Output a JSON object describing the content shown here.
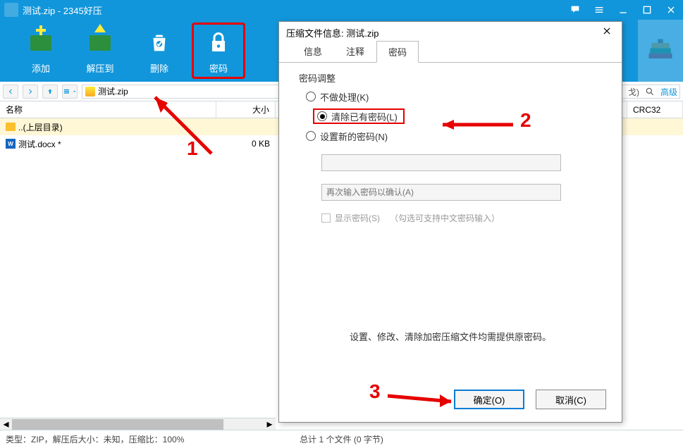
{
  "titlebar": {
    "title": "测试.zip - 2345好压"
  },
  "ribbon": {
    "add": "添加",
    "extract": "解压到",
    "delete": "删除",
    "password": "密码"
  },
  "path": "测试.zip",
  "right_fade": {
    "suffix": "戈)",
    "detail": "高级"
  },
  "columns": {
    "name": "名称",
    "size": "大小",
    "crc": "CRC32"
  },
  "rows": {
    "up": "..(上层目录)",
    "file": "测试.docx *",
    "size": "0 KB"
  },
  "status": {
    "left": "类型：ZIP，解压后大小：未知，压缩比：100%",
    "center": "总计 1 个文件 (0 字节)"
  },
  "modal": {
    "title": "压缩文件信息: 测试.zip",
    "tabs": {
      "info": "信息",
      "comment": "注释",
      "password": "密码"
    },
    "fieldset": "密码调整",
    "r1": "不做处理(K)",
    "r2": "清除已有密码(L)",
    "r3": "设置新的密码(N)",
    "placeholder2": "再次输入密码以确认(A)",
    "show": "显示密码(S)",
    "hint": "（勾选可支持中文密码输入）",
    "bottom": "设置、修改、清除加密压缩文件均需提供原密码。",
    "ok": "确定(O)",
    "cancel": "取消(C)"
  },
  "anno": {
    "n1": "1",
    "n2": "2",
    "n3": "3"
  }
}
